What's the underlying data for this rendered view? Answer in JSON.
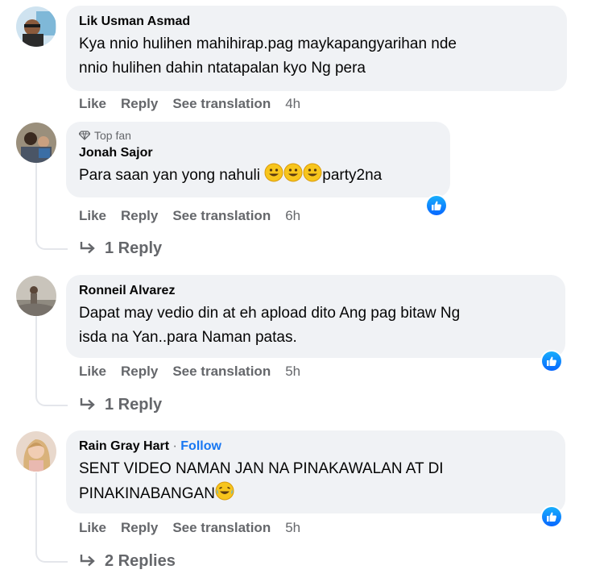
{
  "comments": [
    {
      "author": "Lik Usman Asmad",
      "text_lines": [
        "Kya nnio hulihen mahihirap.pag maykapangyarihan nde",
        "nnio hulihen dahin ntatapalan kyo Ng pera"
      ],
      "like": "Like",
      "reply": "Reply",
      "translate": "See translation",
      "time": "4h"
    },
    {
      "badge": "Top fan",
      "author": "Jonah Sajor",
      "text": "Para saan yan yong nahuli ",
      "text_after_emoji": "party2na",
      "like": "Like",
      "reply": "Reply",
      "translate": "See translation",
      "time": "6h",
      "replies": "1 Reply"
    },
    {
      "author": "Ronneil Alvarez",
      "text_lines": [
        "Dapat may vedio din at eh apload dito Ang pag bitaw Ng",
        "isda na Yan..para Naman patas."
      ],
      "like": "Like",
      "reply": "Reply",
      "translate": "See translation",
      "time": "5h",
      "replies": "1 Reply"
    },
    {
      "author": "Rain Gray Hart",
      "follow_sep": " · ",
      "follow": "Follow",
      "text_lines": [
        "SENT VIDEO NAMAN JAN NA PINAKAWALAN AT DI",
        "PINAKINABANGAN"
      ],
      "like": "Like",
      "reply": "Reply",
      "translate": "See translation",
      "time": "5h",
      "replies": "2 Replies"
    }
  ],
  "colors": {
    "bubble": "#f0f2f5",
    "secondary_text": "#65676b",
    "link_blue": "#1877f2",
    "thread_line": "#e4e6eb"
  },
  "icons": [
    "avatar",
    "diamond-icon",
    "like-reaction-icon",
    "reply-arrow-icon",
    "grinning-emoji",
    "laughing-crying-emoji"
  ]
}
